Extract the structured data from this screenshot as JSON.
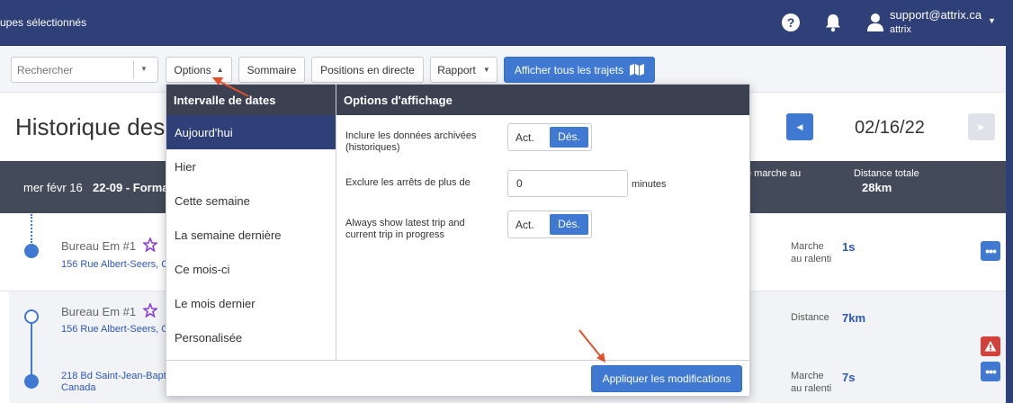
{
  "topbar": {
    "groups_text": "upes sélectionnés",
    "user_email": "support@attrix.ca",
    "user_org": "attrix"
  },
  "toolbar": {
    "search_placeholder": "Rechercher",
    "options_label": "Options",
    "summary_label": "Sommaire",
    "live_positions_label": "Positions en directe",
    "report_label": "Rapport",
    "show_all_trips_label": "Afficher tous les trajets"
  },
  "page": {
    "title": "Historique des",
    "date": "02/16/22"
  },
  "summary_bar": {
    "day": "mer févr 16",
    "trip_name": "22-09 - Forma",
    "idle_header": "e marche au",
    "distance_header": "Distance totale",
    "distance_value": "28km"
  },
  "rows": [
    {
      "place": "Bureau Em #1",
      "address": "156 Rue Albert-Seers, C",
      "metric_label_1": "Marche",
      "metric_label_2": "au ralenti",
      "metric_value": "1s"
    },
    {
      "place": "Bureau Em #1",
      "address": "156 Rue Albert-Seers, C",
      "metric_label_1": "Distance",
      "metric_label_2": "",
      "metric_value": "7km"
    },
    {
      "place": "",
      "address": "218 Bd Saint-Jean-Bapt",
      "address_2": "Canada",
      "metric_label_1": "Marche",
      "metric_label_2": "au ralenti",
      "metric_value": "7s"
    }
  ],
  "dropdown": {
    "date_header": "Intervalle de dates",
    "date_items": [
      "Aujourd'hui",
      "Hier",
      "Cette semaine",
      "La semaine dernière",
      "Ce mois-ci",
      "Le mois dernier",
      "Personalisée"
    ],
    "active_index": 0,
    "options_header": "Options d'affichage",
    "opt_archived_1": "Inclure les données archivées",
    "opt_archived_2": "(historiques)",
    "opt_exclude": "Exclure les arrêts de plus de",
    "exclude_value": "0",
    "minutes_label": "minutes",
    "opt_latest_1": "Always show latest trip and",
    "opt_latest_2": "current trip in progress",
    "toggle_on": "Act.",
    "toggle_off": "Dés.",
    "apply_label": "Appliquer les modifications"
  },
  "colors": {
    "navy": "#2f3f78",
    "primary": "#3f79d1",
    "header_dark": "#3b4150",
    "arrow": "#e0502a",
    "alert": "#d2403a"
  }
}
